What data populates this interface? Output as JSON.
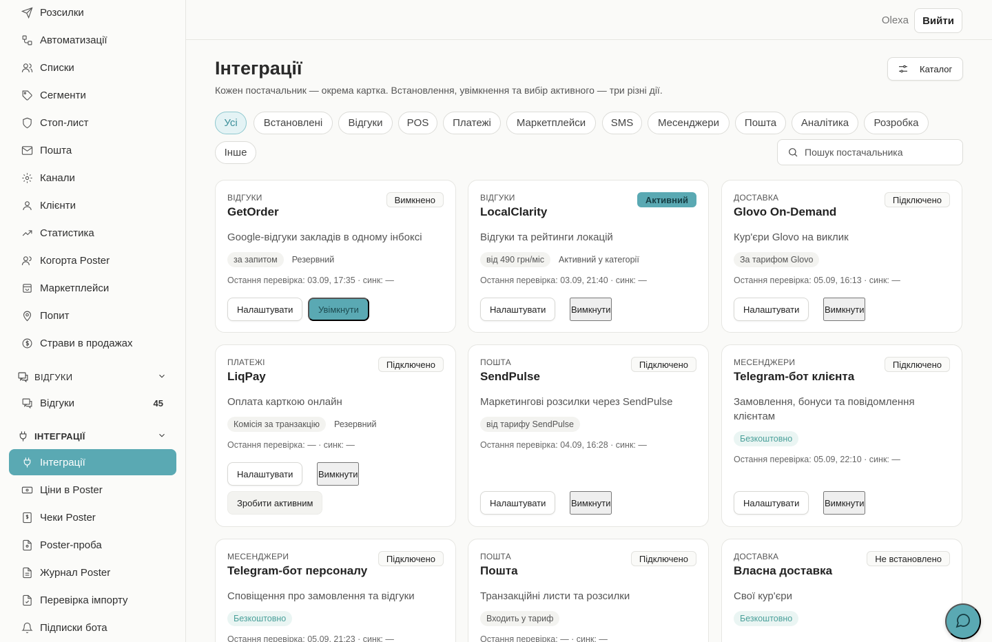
{
  "sidebar": {
    "items_top": [
      {
        "label": "Розсилки",
        "icon": "send-icon"
      },
      {
        "label": "Автоматизації",
        "icon": "workflow-icon"
      },
      {
        "label": "Списки",
        "icon": "users-icon"
      },
      {
        "label": "Сегменти",
        "icon": "tag-icon"
      },
      {
        "label": "Стоп-лист",
        "icon": "shield-icon"
      },
      {
        "label": "Пошта",
        "icon": "mail-icon"
      },
      {
        "label": "Канали",
        "icon": "gear-icon"
      },
      {
        "label": "Клієнти",
        "icon": "user-icon"
      },
      {
        "label": "Статистика",
        "icon": "trend-icon"
      },
      {
        "label": "Когорта Poster",
        "icon": "users-icon"
      },
      {
        "label": "Маркетплейси",
        "icon": "store-icon"
      },
      {
        "label": "Попит",
        "icon": "pin-icon"
      },
      {
        "label": "Страви в продажах",
        "icon": "coin-icon"
      }
    ],
    "group_reviews": {
      "label": "ВІДГУКИ"
    },
    "reviews_item": {
      "label": "Відгуки",
      "count": "45"
    },
    "group_integrations": {
      "label": "ІНТЕГРАЦІЇ"
    },
    "items_integrations": [
      {
        "label": "Інтеграції",
        "active": true
      },
      {
        "label": "Ціни в Poster"
      },
      {
        "label": "Чеки Poster"
      },
      {
        "label": "Poster-проба"
      },
      {
        "label": "Журнал Poster"
      },
      {
        "label": "Перевірка імпорту"
      },
      {
        "label": "Підписки бота"
      }
    ]
  },
  "topbar": {
    "user": "Olexa",
    "logout": "Вийти"
  },
  "main": {
    "title": "Інтеграції",
    "subtitle": "Кожен постачальник — окрема картка. Встановлення, увімкнення та вибір активного — три різні дії.",
    "catalog_button": "Каталог",
    "search_placeholder": "Пошук постачальника",
    "filters": [
      "Усі",
      "Встановлені",
      "Відгуки",
      "POS",
      "Платежі",
      "Маркетплейси",
      "SMS",
      "Месенджери",
      "Пошта",
      "Аналітика",
      "Розробка",
      "Інше"
    ]
  },
  "cards": [
    {
      "category": "ВІДГУКИ",
      "name": "GetOrder",
      "status": "Вимкнено",
      "description": "Google-відгуки закладів в одному інбоксі",
      "tags": [
        "за запитом",
        "Резервний"
      ],
      "check": "Остання перевірка: 03.09, 17:35 · синк: —",
      "btn_settings": "Налаштувати",
      "btn_action": "Увімкнути"
    },
    {
      "category": "ВІДГУКИ",
      "name": "LocalClarity",
      "status": "Активний",
      "description": "Відгуки та рейтинги локацій",
      "tags": [
        "від 490 грн/міс",
        "Активний у категорії"
      ],
      "check": "Остання перевірка: 03.09, 21:40 · синк: —",
      "btn_settings": "Налаштувати",
      "btn_action": "Вимкнути"
    },
    {
      "category": "ДОСТАВКА",
      "name": "Glovo On-Demand",
      "status": "Підключено",
      "description": "Кур'єри Glovo на виклик",
      "tags": [
        "За тарифом Glovo"
      ],
      "check": "Остання перевірка: 05.09, 16:13 · синк: —",
      "btn_settings": "Налаштувати",
      "btn_action": "Вимкнути"
    },
    {
      "category": "ПЛАТЕЖІ",
      "name": "LiqPay",
      "status": "Підключено",
      "description": "Оплата карткою онлайн",
      "tags": [
        "Комісія за транзакцію",
        "Резервний"
      ],
      "check": "Остання перевірка: — · синк: —",
      "btn_settings": "Налаштувати",
      "btn_action": "Вимкнути",
      "btn_extra": "Зробити активним"
    },
    {
      "category": "ПОШТА",
      "name": "SendPulse",
      "status": "Підключено",
      "description": "Маркетингові розсилки через SendPulse",
      "tags": [
        "від тарифу SendPulse"
      ],
      "check": "Остання перевірка: 04.09, 16:28 · синк: —",
      "btn_settings": "Налаштувати",
      "btn_action": "Вимкнути"
    },
    {
      "category": "МЕСЕНДЖЕРИ",
      "name": "Telegram-бот клієнта",
      "status": "Підключено",
      "description": "Замовлення, бонуси та повідомлення клієнтам",
      "tags": [
        "Безкоштовно"
      ],
      "check": "Остання перевірка: 05.09, 22:10 · синк: —",
      "btn_settings": "Налаштувати",
      "btn_action": "Вимкнути"
    },
    {
      "category": "МЕСЕНДЖЕРИ",
      "name": "Telegram-бот персоналу",
      "status": "Підключено",
      "description": "Сповіщення про замовлення та відгуки",
      "tags": [
        "Безкоштовно"
      ],
      "check": "Остання перевірка: 05.09, 21:23 · синк: —"
    },
    {
      "category": "ПОШТА",
      "name": "Пошта",
      "status": "Підключено",
      "description": "Транзакційні листи та розсилки",
      "tags": [
        "Входить у тариф"
      ],
      "check": "Остання перевірка: — · синк: —"
    },
    {
      "category": "ДОСТАВКА",
      "name": "Власна доставка",
      "status": "Не встановлено",
      "description": "Свої кур'єри",
      "tags": [
        "Безкоштовно"
      ]
    }
  ],
  "colors": {
    "accent": "#5aa9b3",
    "chip_active_bg": "#e4f3f5",
    "free_tag": "#4aa09a"
  }
}
